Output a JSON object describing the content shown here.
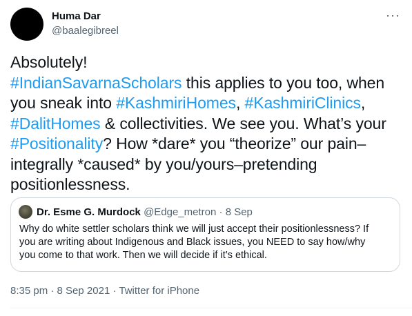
{
  "author": {
    "display_name": "Huma Dar",
    "handle": "@baalegibreel"
  },
  "more_icon": "more-horizontal-icon",
  "more_glyph": "···",
  "tweet": {
    "lines": [
      [
        {
          "text": "Absolutely!"
        }
      ],
      [
        {
          "text": "#IndianSavarnaScholars",
          "tag": true
        },
        {
          "text": " this applies to you too, when"
        }
      ],
      [
        {
          "text": "you sneak into "
        },
        {
          "text": "#KashmiriHomes",
          "tag": true
        },
        {
          "text": ", "
        },
        {
          "text": "#KashmiriClinics",
          "tag": true
        },
        {
          "text": ","
        }
      ],
      [
        {
          "text": "#DalitHomes",
          "tag": true
        },
        {
          "text": " & collectivities. We see you. What’s your"
        }
      ],
      [
        {
          "text": "#Positionality",
          "tag": true
        },
        {
          "text": "? How *dare* you “theorize” our pain–"
        }
      ],
      [
        {
          "text": "integrally *caused* by you/yours–pretending"
        }
      ],
      [
        {
          "text": "positionlessness."
        }
      ]
    ]
  },
  "quoted": {
    "display_name": "Dr. Esme G. Murdock",
    "handle": "@Edge_metron",
    "separator": " · ",
    "date": "8 Sep",
    "lines": [
      "Why do white settler scholars think we will just accept their positionlessness? If",
      "you are writing about Indigenous and Black issues, you NEED to say how/why",
      "you come to that work. Then we will decide if it’s ethical."
    ]
  },
  "footer": {
    "time": "8:35 pm",
    "separator": " · ",
    "date": "8 Sep 2021",
    "source": "Twitter for iPhone"
  },
  "colors": {
    "link": "#1d9bf0",
    "muted": "#536471",
    "text": "#0f1419",
    "border": "#cfd9de"
  }
}
